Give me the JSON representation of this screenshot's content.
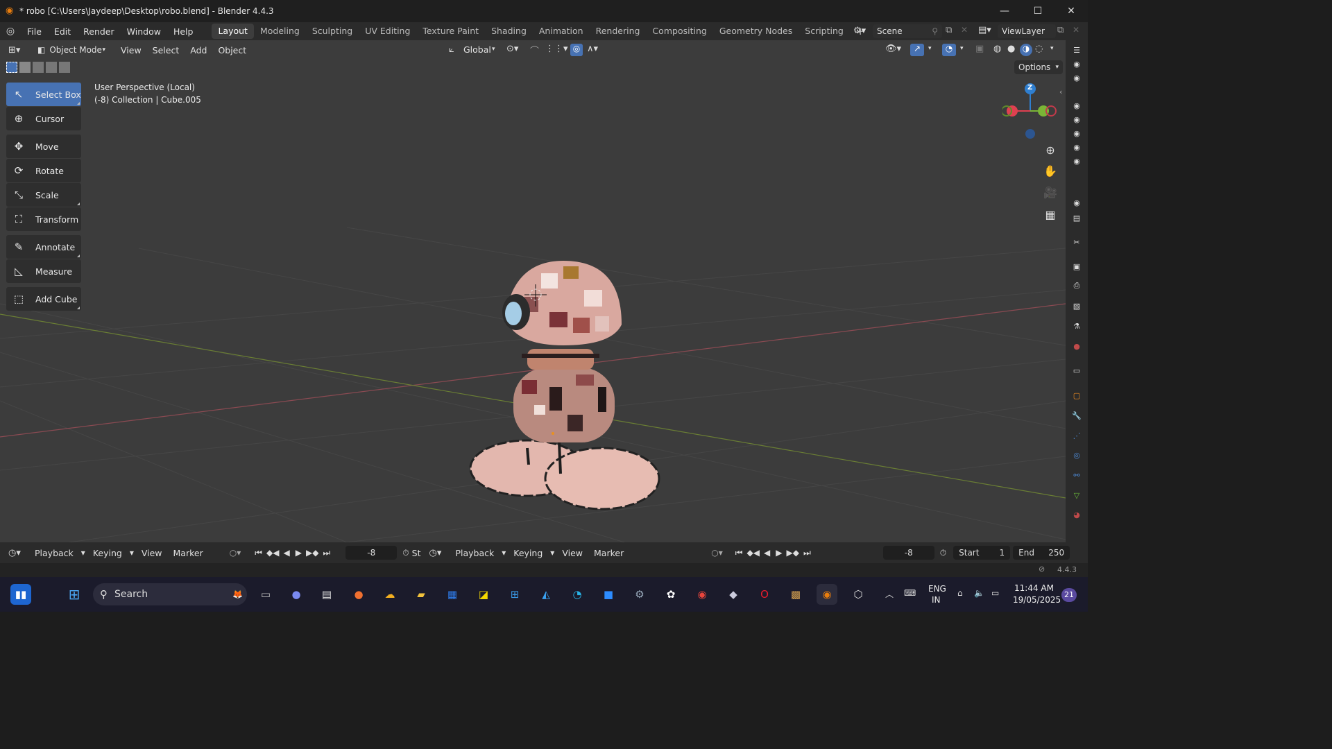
{
  "window": {
    "title": "* robo [C:\\Users\\Jaydeep\\Desktop\\robo.blend] - Blender 4.4.3"
  },
  "menu": [
    "File",
    "Edit",
    "Render",
    "Window",
    "Help"
  ],
  "workspaces": [
    "Layout",
    "Modeling",
    "Sculpting",
    "UV Editing",
    "Texture Paint",
    "Shading",
    "Animation",
    "Rendering",
    "Compositing",
    "Geometry Nodes",
    "Scripting"
  ],
  "add_workspace": "+",
  "scene": {
    "name": "Scene"
  },
  "view_layer": {
    "name": "ViewLayer"
  },
  "viewport_header": {
    "mode": "Object Mode",
    "menus": [
      "View",
      "Select",
      "Add",
      "Object"
    ],
    "orientation": "Global",
    "options": "Options"
  },
  "toolbar": [
    {
      "label": "Select Box",
      "icon": "select-box-icon",
      "glyph": "↖",
      "selected": true
    },
    {
      "label": "Cursor",
      "icon": "cursor-icon",
      "glyph": "⊕"
    },
    {
      "label": "Move",
      "icon": "move-icon",
      "glyph": "✥"
    },
    {
      "label": "Rotate",
      "icon": "rotate-icon",
      "glyph": "⟳"
    },
    {
      "label": "Scale",
      "icon": "scale-icon",
      "glyph": "⤡"
    },
    {
      "label": "Transform",
      "icon": "transform-icon",
      "glyph": "⛶"
    },
    {
      "label": "Annotate",
      "icon": "annotate-icon",
      "glyph": "✎"
    },
    {
      "label": "Measure",
      "icon": "measure-icon",
      "glyph": "📐"
    },
    {
      "label": "Add Cube",
      "icon": "add-cube-icon",
      "glyph": "⬚"
    }
  ],
  "overlay": {
    "perspective": "User Perspective (Local)",
    "context": "(-8) Collection | Cube.005"
  },
  "gizmo": {
    "z_label": "Z",
    "x_color": "#e04050",
    "y_color": "#7ab536",
    "z_color": "#2f7fd0"
  },
  "timeline_left": {
    "menus": [
      "Playback",
      "Keying",
      "View",
      "Marker"
    ],
    "current_frame": "-8",
    "truncated": "St"
  },
  "timeline_right": {
    "menus": [
      "Playback",
      "Keying",
      "View",
      "Marker"
    ],
    "current_frame": "-8",
    "start_label": "Start",
    "start_value": "1",
    "end_label": "End",
    "end_value": "250"
  },
  "status": {
    "version": "4.4.3"
  },
  "taskbar": {
    "search": "Search",
    "lang_top": "ENG",
    "lang_bottom": "IN",
    "time": "11:44 AM",
    "date": "19/05/2025",
    "notification_count": "21"
  },
  "colors": {
    "accent": "#4772b3",
    "viewport_bg": "#3c3c3c",
    "panel_bg": "#2b2b2b"
  }
}
